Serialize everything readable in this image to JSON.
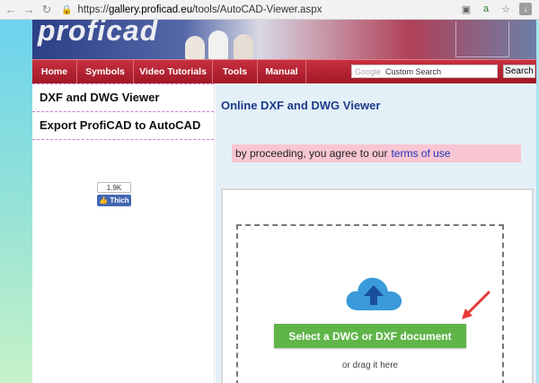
{
  "browser": {
    "url_prefix": "https://",
    "url_host": "gallery.proficad.eu",
    "url_path": "/tools/AutoCAD-Viewer.aspx",
    "icons": [
      "back-icon",
      "forward-icon",
      "reload-icon",
      "lock-icon",
      "translate-icon",
      "extension-icon",
      "star-icon",
      "download-icon"
    ]
  },
  "banner": {
    "logo_text": "proficad"
  },
  "nav": {
    "items": [
      "Home",
      "Symbols",
      "Video Tutorials",
      "Tools",
      "Manual"
    ],
    "search_brand": "Google",
    "search_placeholder": "Custom Search",
    "search_button": "Search"
  },
  "sidebar": {
    "links": [
      "DXF and DWG Viewer",
      "Export ProfiCAD to AutoCAD"
    ],
    "like_count": "1.9K",
    "like_label": "Thich"
  },
  "main": {
    "title": "Online DXF and DWG Viewer",
    "notice_text": "by proceeding, you agree to our",
    "terms_link": "terms of use",
    "select_button": "Select a DWG or DXF document",
    "drag_hint": "or drag it here"
  },
  "colors": {
    "nav_red": "#b0202f",
    "button_green": "#5fb548",
    "title_blue": "#1d3a8a",
    "notice_pink": "#f8c6d3",
    "annotation_arrow": "#e53935"
  }
}
